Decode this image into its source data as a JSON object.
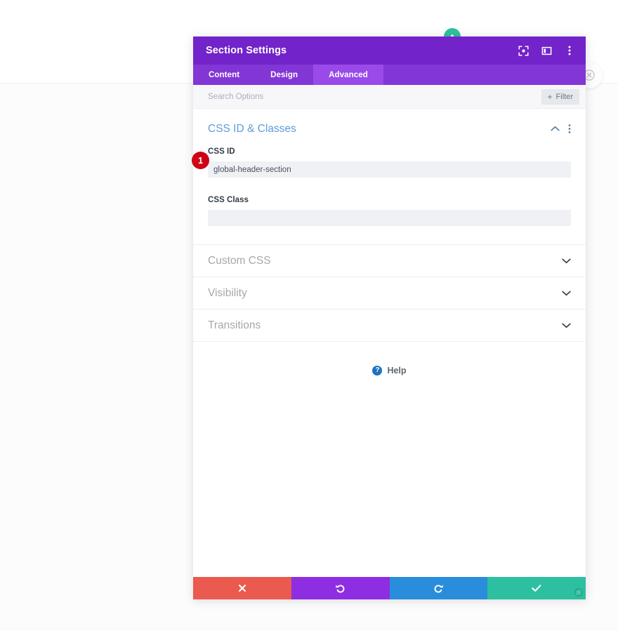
{
  "window": {
    "title": "Section Settings",
    "header_icons": [
      {
        "name": "expand-view-icon",
        "label": "Expand view"
      },
      {
        "name": "layout-panel-icon",
        "label": "Change layout"
      },
      {
        "name": "more-options-icon",
        "label": "More options"
      }
    ]
  },
  "tabs": [
    {
      "id": "content",
      "label": "Content",
      "active": false
    },
    {
      "id": "design",
      "label": "Design",
      "active": false
    },
    {
      "id": "advanced",
      "label": "Advanced",
      "active": true
    }
  ],
  "search": {
    "value": "",
    "placeholder": "Search Options",
    "filter_label": "Filter",
    "filter_plus": "+"
  },
  "groups": {
    "open": {
      "title": "CSS ID & Classes",
      "collapse_icon": "chevron-up-icon",
      "menu_icon": "more-options-icon",
      "fields": [
        {
          "label": "CSS ID",
          "value": "global-header-section",
          "placeholder": ""
        },
        {
          "label": "CSS Class",
          "value": "",
          "placeholder": ""
        }
      ]
    },
    "collapsed": [
      {
        "title": "Custom CSS",
        "icon": "chevron-down-icon"
      },
      {
        "title": "Visibility",
        "icon": "chevron-down-icon"
      },
      {
        "title": "Transitions",
        "icon": "chevron-down-icon"
      }
    ]
  },
  "help": {
    "label": "Help",
    "icon_glyph": "?"
  },
  "footer": {
    "buttons": [
      {
        "name": "cancel-button",
        "glyph": "✖",
        "color": "#ea5a4f",
        "title": "Discard changes"
      },
      {
        "name": "undo-button",
        "glyph": "↺",
        "color": "#8e2de2",
        "title": "Undo"
      },
      {
        "name": "redo-button",
        "glyph": "↻",
        "color": "#2a8ddb",
        "title": "Redo"
      },
      {
        "name": "save-button",
        "glyph": "✔",
        "color": "#2cc0a0",
        "title": "Save changes"
      }
    ]
  },
  "markers": {
    "step_one": "1"
  },
  "colors": {
    "header_purple": "#7323ca",
    "tabbar_purple": "#8236d6",
    "tab_active_purple": "#9a4ae8",
    "group_title_blue": "#5b9dd9",
    "marker_red": "#d00014",
    "badge_teal": "#2ec0a0",
    "help_blue": "#1e73be"
  }
}
